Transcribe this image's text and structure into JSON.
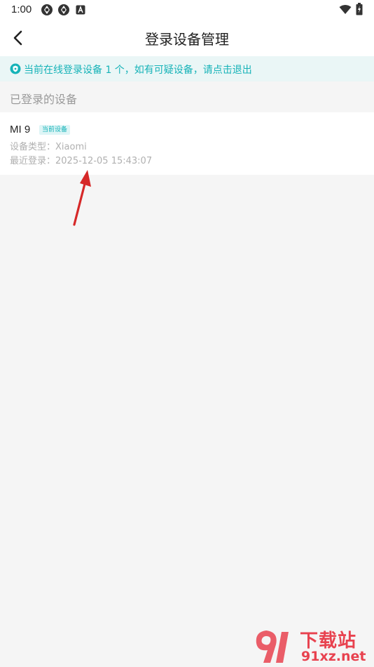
{
  "status_bar": {
    "time": "1:00",
    "icons": [
      "aperture-icon",
      "aperture-icon",
      "font-a-icon"
    ],
    "right_icons": [
      "wifi-icon",
      "battery-icon"
    ]
  },
  "app_bar": {
    "back_icon": "chevron-left-icon",
    "title": "登录设备管理"
  },
  "notice": {
    "icon": "shield-icon",
    "text": "当前在线登录设备 1 个，如有可疑设备，请点击退出"
  },
  "section": {
    "label": "已登录的设备"
  },
  "devices": [
    {
      "name": "MI 9",
      "badge": "当前设备",
      "type_label": "设备类型：",
      "type_value": "Xiaomi",
      "last_login_label": "最近登录：",
      "last_login_value": "2025-12-05 15:43:07"
    }
  ],
  "watermark": {
    "line1": "下载站",
    "line2": "91xz.net"
  },
  "colors": {
    "accent": "#16b3b8",
    "notice_bg": "#eaf6f6",
    "page_bg": "#f5f5f5",
    "arrow": "#d62828",
    "watermark": "#e8424f"
  }
}
